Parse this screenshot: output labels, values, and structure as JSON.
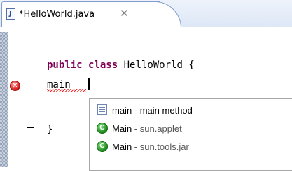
{
  "tab": {
    "title": "*HelloWorld.java",
    "file_icon_letter": "J",
    "close_glyph": "✕"
  },
  "editor": {
    "line1_keyword1": "public",
    "line1_keyword2": "class",
    "line1_rest": " HelloWorld {",
    "line2_text": "main",
    "line3_text": "}",
    "error_icon_glyph": "✕"
  },
  "content_assist": {
    "items": [
      {
        "icon": "method-icon",
        "main": "main - main method",
        "sub": ""
      },
      {
        "icon": "class-icon",
        "main": "Main",
        "sub": " - sun.applet"
      },
      {
        "icon": "class-icon",
        "main": "Main",
        "sub": " - sun.tools.jar"
      }
    ],
    "class_icon_letter": "C"
  }
}
